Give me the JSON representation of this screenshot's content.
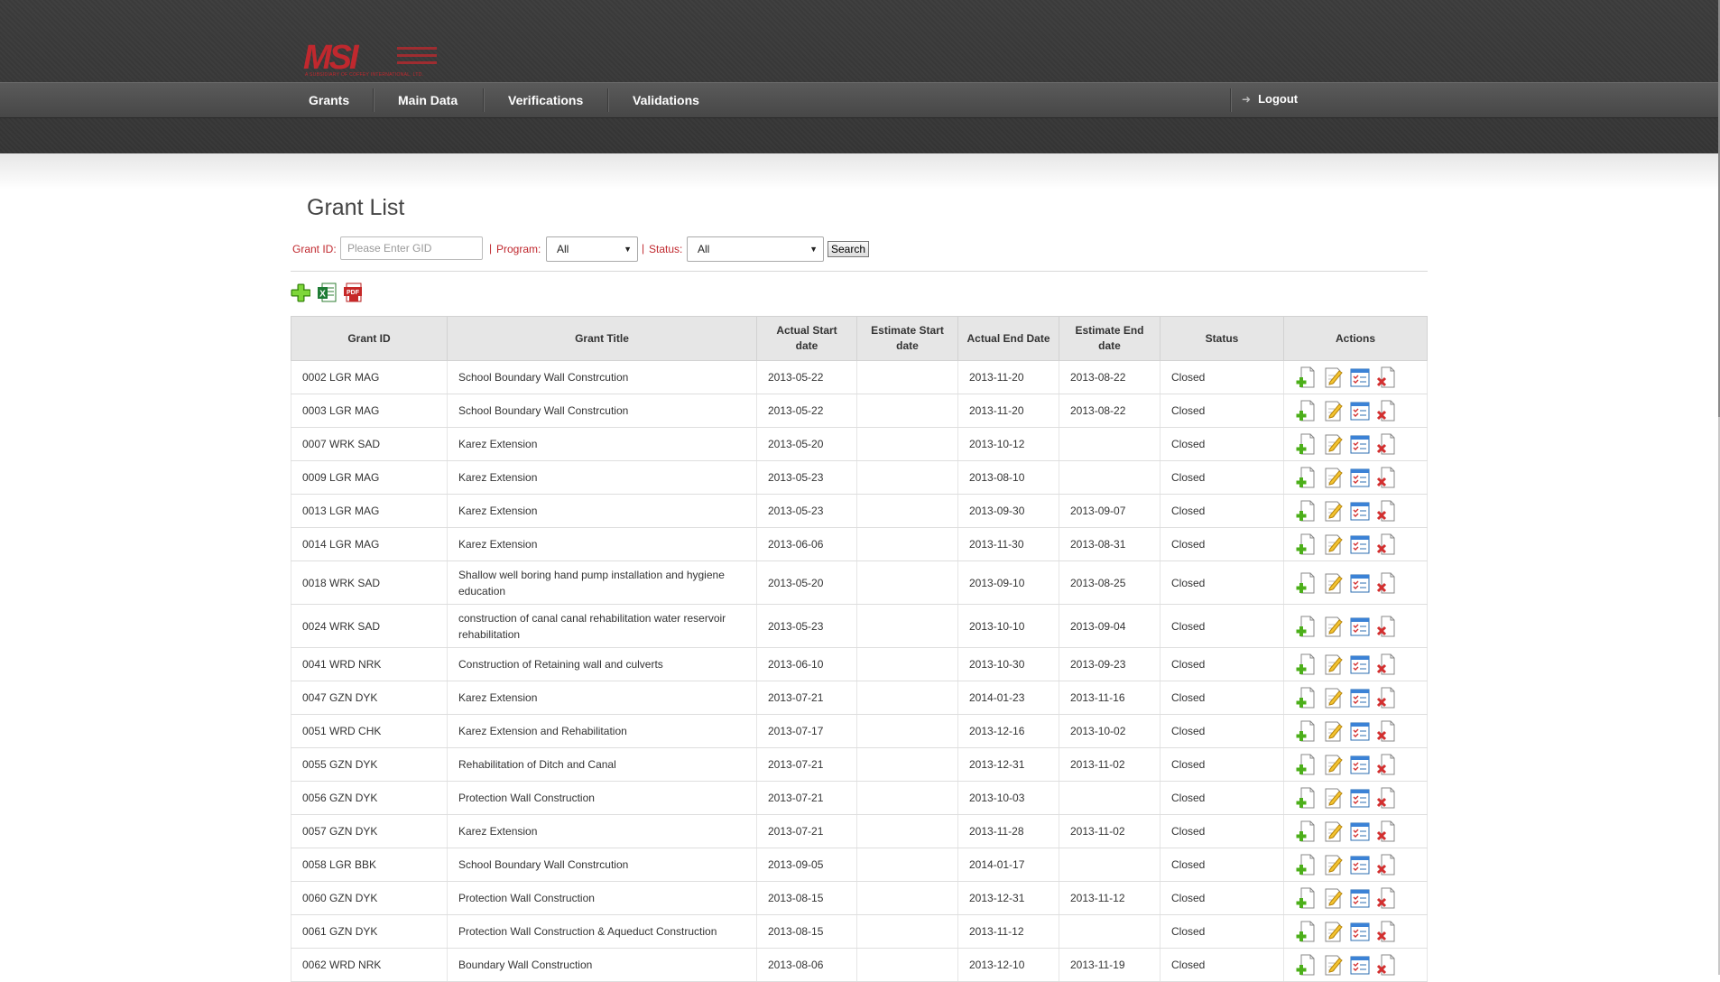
{
  "header": {
    "logo_text": "MSI",
    "logo_tagline": "A SUBSIDIARY OF COFFEY INTERNATIONAL, LTD.",
    "nav": [
      {
        "label": "Grants"
      },
      {
        "label": "Main Data"
      },
      {
        "label": "Verifications"
      },
      {
        "label": "Validations"
      }
    ],
    "logout_label": "Logout"
  },
  "page": {
    "title": "Grant List"
  },
  "filters": {
    "grant_id_label": "Grant ID:",
    "grant_id_placeholder": "Please Enter GID",
    "grant_id_value": "",
    "separator": "|",
    "program_label": "Program:",
    "program_selected": "All",
    "status_label": "Status:",
    "status_selected": "All",
    "search_label": "Search"
  },
  "toolbar": {
    "icons": [
      "add-grant-icon",
      "export-excel-icon",
      "export-pdf-icon"
    ]
  },
  "colors": {
    "brand": "#c0282e",
    "header_bg": "#3b3b3b",
    "nav_bg": "#4e4e4e",
    "table_header_bg": "#e6e6e6"
  },
  "table": {
    "columns": [
      "Grant ID",
      "Grant Title",
      "Actual Start date",
      "Estimate Start date",
      "Actual End Date",
      "Estimate End date",
      "Status",
      "Actions"
    ],
    "action_icons": [
      "add-icon",
      "edit-icon",
      "checklist-icon",
      "delete-icon"
    ],
    "rows": [
      {
        "id": "0002 LGR MAG",
        "title": "School Boundary Wall Constrcution",
        "actual_start": "2013-05-22",
        "estimate_start": "",
        "actual_end": "2013-11-20",
        "estimate_end": "2013-08-22",
        "status": "Closed"
      },
      {
        "id": "0003 LGR MAG",
        "title": "School Boundary Wall Constrcution",
        "actual_start": "2013-05-22",
        "estimate_start": "",
        "actual_end": "2013-11-20",
        "estimate_end": "2013-08-22",
        "status": "Closed"
      },
      {
        "id": "0007 WRK SAD",
        "title": "Karez Extension",
        "actual_start": "2013-05-20",
        "estimate_start": "",
        "actual_end": "2013-10-12",
        "estimate_end": "",
        "status": "Closed"
      },
      {
        "id": "0009 LGR MAG",
        "title": "Karez Extension",
        "actual_start": "2013-05-23",
        "estimate_start": "",
        "actual_end": "2013-08-10",
        "estimate_end": "",
        "status": "Closed"
      },
      {
        "id": "0013 LGR MAG",
        "title": "Karez Extension",
        "actual_start": "2013-05-23",
        "estimate_start": "",
        "actual_end": "2013-09-30",
        "estimate_end": "2013-09-07",
        "status": "Closed"
      },
      {
        "id": "0014 LGR MAG",
        "title": "Karez Extension",
        "actual_start": "2013-06-06",
        "estimate_start": "",
        "actual_end": "2013-11-30",
        "estimate_end": "2013-08-31",
        "status": "Closed"
      },
      {
        "id": "0018 WRK SAD",
        "title": "Shallow well boring hand pump installation and hygiene education",
        "actual_start": "2013-05-20",
        "estimate_start": "",
        "actual_end": "2013-09-10",
        "estimate_end": "2013-08-25",
        "status": "Closed"
      },
      {
        "id": "0024 WRK SAD",
        "title": "construction of canal canal rehabilitation water reservoir rehabilitation",
        "actual_start": "2013-05-23",
        "estimate_start": "",
        "actual_end": "2013-10-10",
        "estimate_end": "2013-09-04",
        "status": "Closed"
      },
      {
        "id": "0041 WRD NRK",
        "title": "Construction of Retaining wall and culverts",
        "actual_start": "2013-06-10",
        "estimate_start": "",
        "actual_end": "2013-10-30",
        "estimate_end": "2013-09-23",
        "status": "Closed"
      },
      {
        "id": "0047 GZN DYK",
        "title": "Karez Extension",
        "actual_start": "2013-07-21",
        "estimate_start": "",
        "actual_end": "2014-01-23",
        "estimate_end": "2013-11-16",
        "status": "Closed"
      },
      {
        "id": "0051 WRD CHK",
        "title": "Karez Extension and Rehabilitation",
        "actual_start": "2013-07-17",
        "estimate_start": "",
        "actual_end": "2013-12-16",
        "estimate_end": "2013-10-02",
        "status": "Closed"
      },
      {
        "id": "0055 GZN DYK",
        "title": "Rehabilitation of Ditch and Canal",
        "actual_start": "2013-07-21",
        "estimate_start": "",
        "actual_end": "2013-12-31",
        "estimate_end": "2013-11-02",
        "status": "Closed"
      },
      {
        "id": "0056 GZN DYK",
        "title": "Protection Wall Construction",
        "actual_start": "2013-07-21",
        "estimate_start": "",
        "actual_end": "2013-10-03",
        "estimate_end": "",
        "status": "Closed"
      },
      {
        "id": "0057 GZN DYK",
        "title": "Karez Extension",
        "actual_start": "2013-07-21",
        "estimate_start": "",
        "actual_end": "2013-11-28",
        "estimate_end": "2013-11-02",
        "status": "Closed"
      },
      {
        "id": "0058 LGR BBK",
        "title": "School Boundary Wall Constrcution",
        "actual_start": "2013-09-05",
        "estimate_start": "",
        "actual_end": "2014-01-17",
        "estimate_end": "",
        "status": "Closed"
      },
      {
        "id": "0060 GZN DYK",
        "title": "Protection Wall Construction",
        "actual_start": "2013-08-15",
        "estimate_start": "",
        "actual_end": "2013-12-31",
        "estimate_end": "2013-11-12",
        "status": "Closed"
      },
      {
        "id": "0061 GZN DYK",
        "title": "Protection Wall Construction & Aqueduct Construction",
        "actual_start": "2013-08-15",
        "estimate_start": "",
        "actual_end": "2013-11-12",
        "estimate_end": "",
        "status": "Closed"
      },
      {
        "id": "0062 WRD NRK",
        "title": "Boundary Wall Construction",
        "actual_start": "2013-08-06",
        "estimate_start": "",
        "actual_end": "2013-12-10",
        "estimate_end": "2013-11-19",
        "status": "Closed"
      }
    ]
  }
}
